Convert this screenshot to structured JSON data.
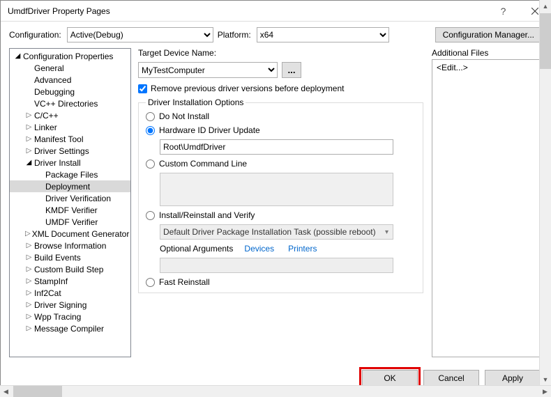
{
  "window": {
    "title": "UmdfDriver Property Pages"
  },
  "toprow": {
    "config_label": "Configuration:",
    "config_value": "Active(Debug)",
    "platform_label": "Platform:",
    "platform_value": "x64",
    "config_mgr": "Configuration Manager..."
  },
  "tree": {
    "items": [
      {
        "label": "Configuration Properties",
        "level": 1,
        "exp": "open"
      },
      {
        "label": "General",
        "level": 2
      },
      {
        "label": "Advanced",
        "level": 2
      },
      {
        "label": "Debugging",
        "level": 2
      },
      {
        "label": "VC++ Directories",
        "level": 2
      },
      {
        "label": "C/C++",
        "level": 2,
        "exp": "closed"
      },
      {
        "label": "Linker",
        "level": 2,
        "exp": "closed"
      },
      {
        "label": "Manifest Tool",
        "level": 2,
        "exp": "closed"
      },
      {
        "label": "Driver Settings",
        "level": 2,
        "exp": "closed"
      },
      {
        "label": "Driver Install",
        "level": 2,
        "exp": "open"
      },
      {
        "label": "Package Files",
        "level": 3
      },
      {
        "label": "Deployment",
        "level": 3,
        "selected": true
      },
      {
        "label": "Driver Verification",
        "level": 3
      },
      {
        "label": "KMDF Verifier",
        "level": 3
      },
      {
        "label": "UMDF Verifier",
        "level": 3
      },
      {
        "label": "XML Document Generator",
        "level": 2,
        "exp": "closed"
      },
      {
        "label": "Browse Information",
        "level": 2,
        "exp": "closed"
      },
      {
        "label": "Build Events",
        "level": 2,
        "exp": "closed"
      },
      {
        "label": "Custom Build Step",
        "level": 2,
        "exp": "closed"
      },
      {
        "label": "StampInf",
        "level": 2,
        "exp": "closed"
      },
      {
        "label": "Inf2Cat",
        "level": 2,
        "exp": "closed"
      },
      {
        "label": "Driver Signing",
        "level": 2,
        "exp": "closed"
      },
      {
        "label": "Wpp Tracing",
        "level": 2,
        "exp": "closed"
      },
      {
        "label": "Message Compiler",
        "level": 2,
        "exp": "closed"
      }
    ]
  },
  "main": {
    "target_label": "Target Device Name:",
    "target_value": "MyTestComputer",
    "browse": "...",
    "remove_prev_label": "Remove previous driver versions before deployment",
    "remove_prev_checked": true,
    "group_legend": "Driver Installation Options",
    "radios": {
      "do_not_install": "Do Not Install",
      "hwid": "Hardware ID Driver Update",
      "hwid_value": "Root\\UmdfDriver",
      "custom": "Custom Command Line",
      "custom_value": "",
      "install_verify": "Install/Reinstall and Verify",
      "task_value": "Default Driver Package Installation Task (possible reboot)",
      "opt_args_label": "Optional Arguments",
      "link_devices": "Devices",
      "link_printers": "Printers",
      "fast": "Fast Reinstall",
      "selected": "hwid"
    },
    "add_files_label": "Additional Files",
    "add_files_value": "<Edit...>"
  },
  "footer": {
    "ok": "OK",
    "cancel": "Cancel",
    "apply": "Apply"
  }
}
